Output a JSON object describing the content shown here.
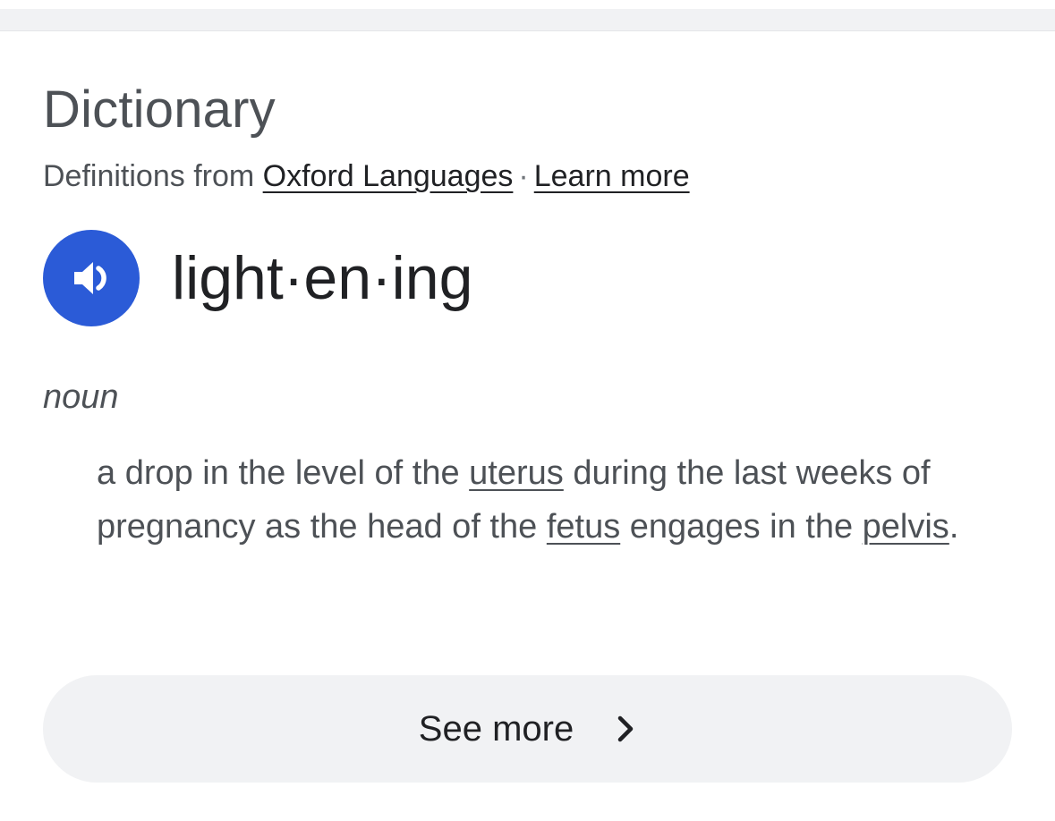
{
  "card": {
    "title": "Dictionary",
    "source": {
      "prefix": "Definitions from ",
      "provider_link": "Oxford Languages",
      "separator": "·",
      "learn_more_link": "Learn more"
    },
    "entry": {
      "headword": "light·en·ing",
      "speaker_icon": "volume-icon",
      "part_of_speech": "noun",
      "definition": {
        "seg1": "a drop in the level of the ",
        "link1": "uterus",
        "seg2": " during the last weeks of pregnancy as the head of the ",
        "link2": "fetus",
        "seg3": " engages in the ",
        "link3": "pelvis",
        "seg4": "."
      }
    },
    "see_more": {
      "label": "See more",
      "icon": "chevron-right-icon"
    }
  },
  "colors": {
    "speaker_button": "#2b5bd7",
    "see_more_background": "#f1f2f4",
    "heading_text": "#4d5156",
    "primary_text": "#202124"
  }
}
